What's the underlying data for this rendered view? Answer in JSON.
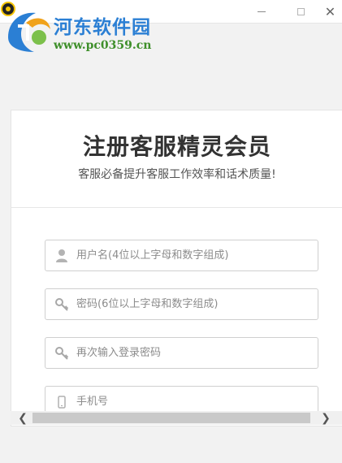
{
  "window": {
    "minimize_icon": "minimize-icon",
    "maximize_icon": "maximize-icon",
    "close_glyph": "✕"
  },
  "watermark": {
    "site_name": "河东软件园",
    "url": "www.pc0359.cn"
  },
  "form": {
    "title": "注册客服精灵会员",
    "subtitle": "客服必备提升客服工作效率和话术质量!",
    "fields": [
      {
        "icon": "user-icon",
        "placeholder": "用户名(4位以上字母和数字组成)",
        "value": ""
      },
      {
        "icon": "key-icon",
        "placeholder": "密码(6位以上字母和数字组成)",
        "value": ""
      },
      {
        "icon": "key-icon",
        "placeholder": "再次输入登录密码",
        "value": ""
      },
      {
        "icon": "phone-icon",
        "placeholder": "手机号",
        "value": ""
      }
    ]
  },
  "scrollbar": {
    "left_arrow": "❮",
    "right_arrow": "❯"
  },
  "colors": {
    "title_text": "#333333",
    "watermark_blue": "#2b7fd4",
    "watermark_green": "#3e8f2a",
    "border": "#cfcfcf",
    "background": "#f2f2f2"
  }
}
